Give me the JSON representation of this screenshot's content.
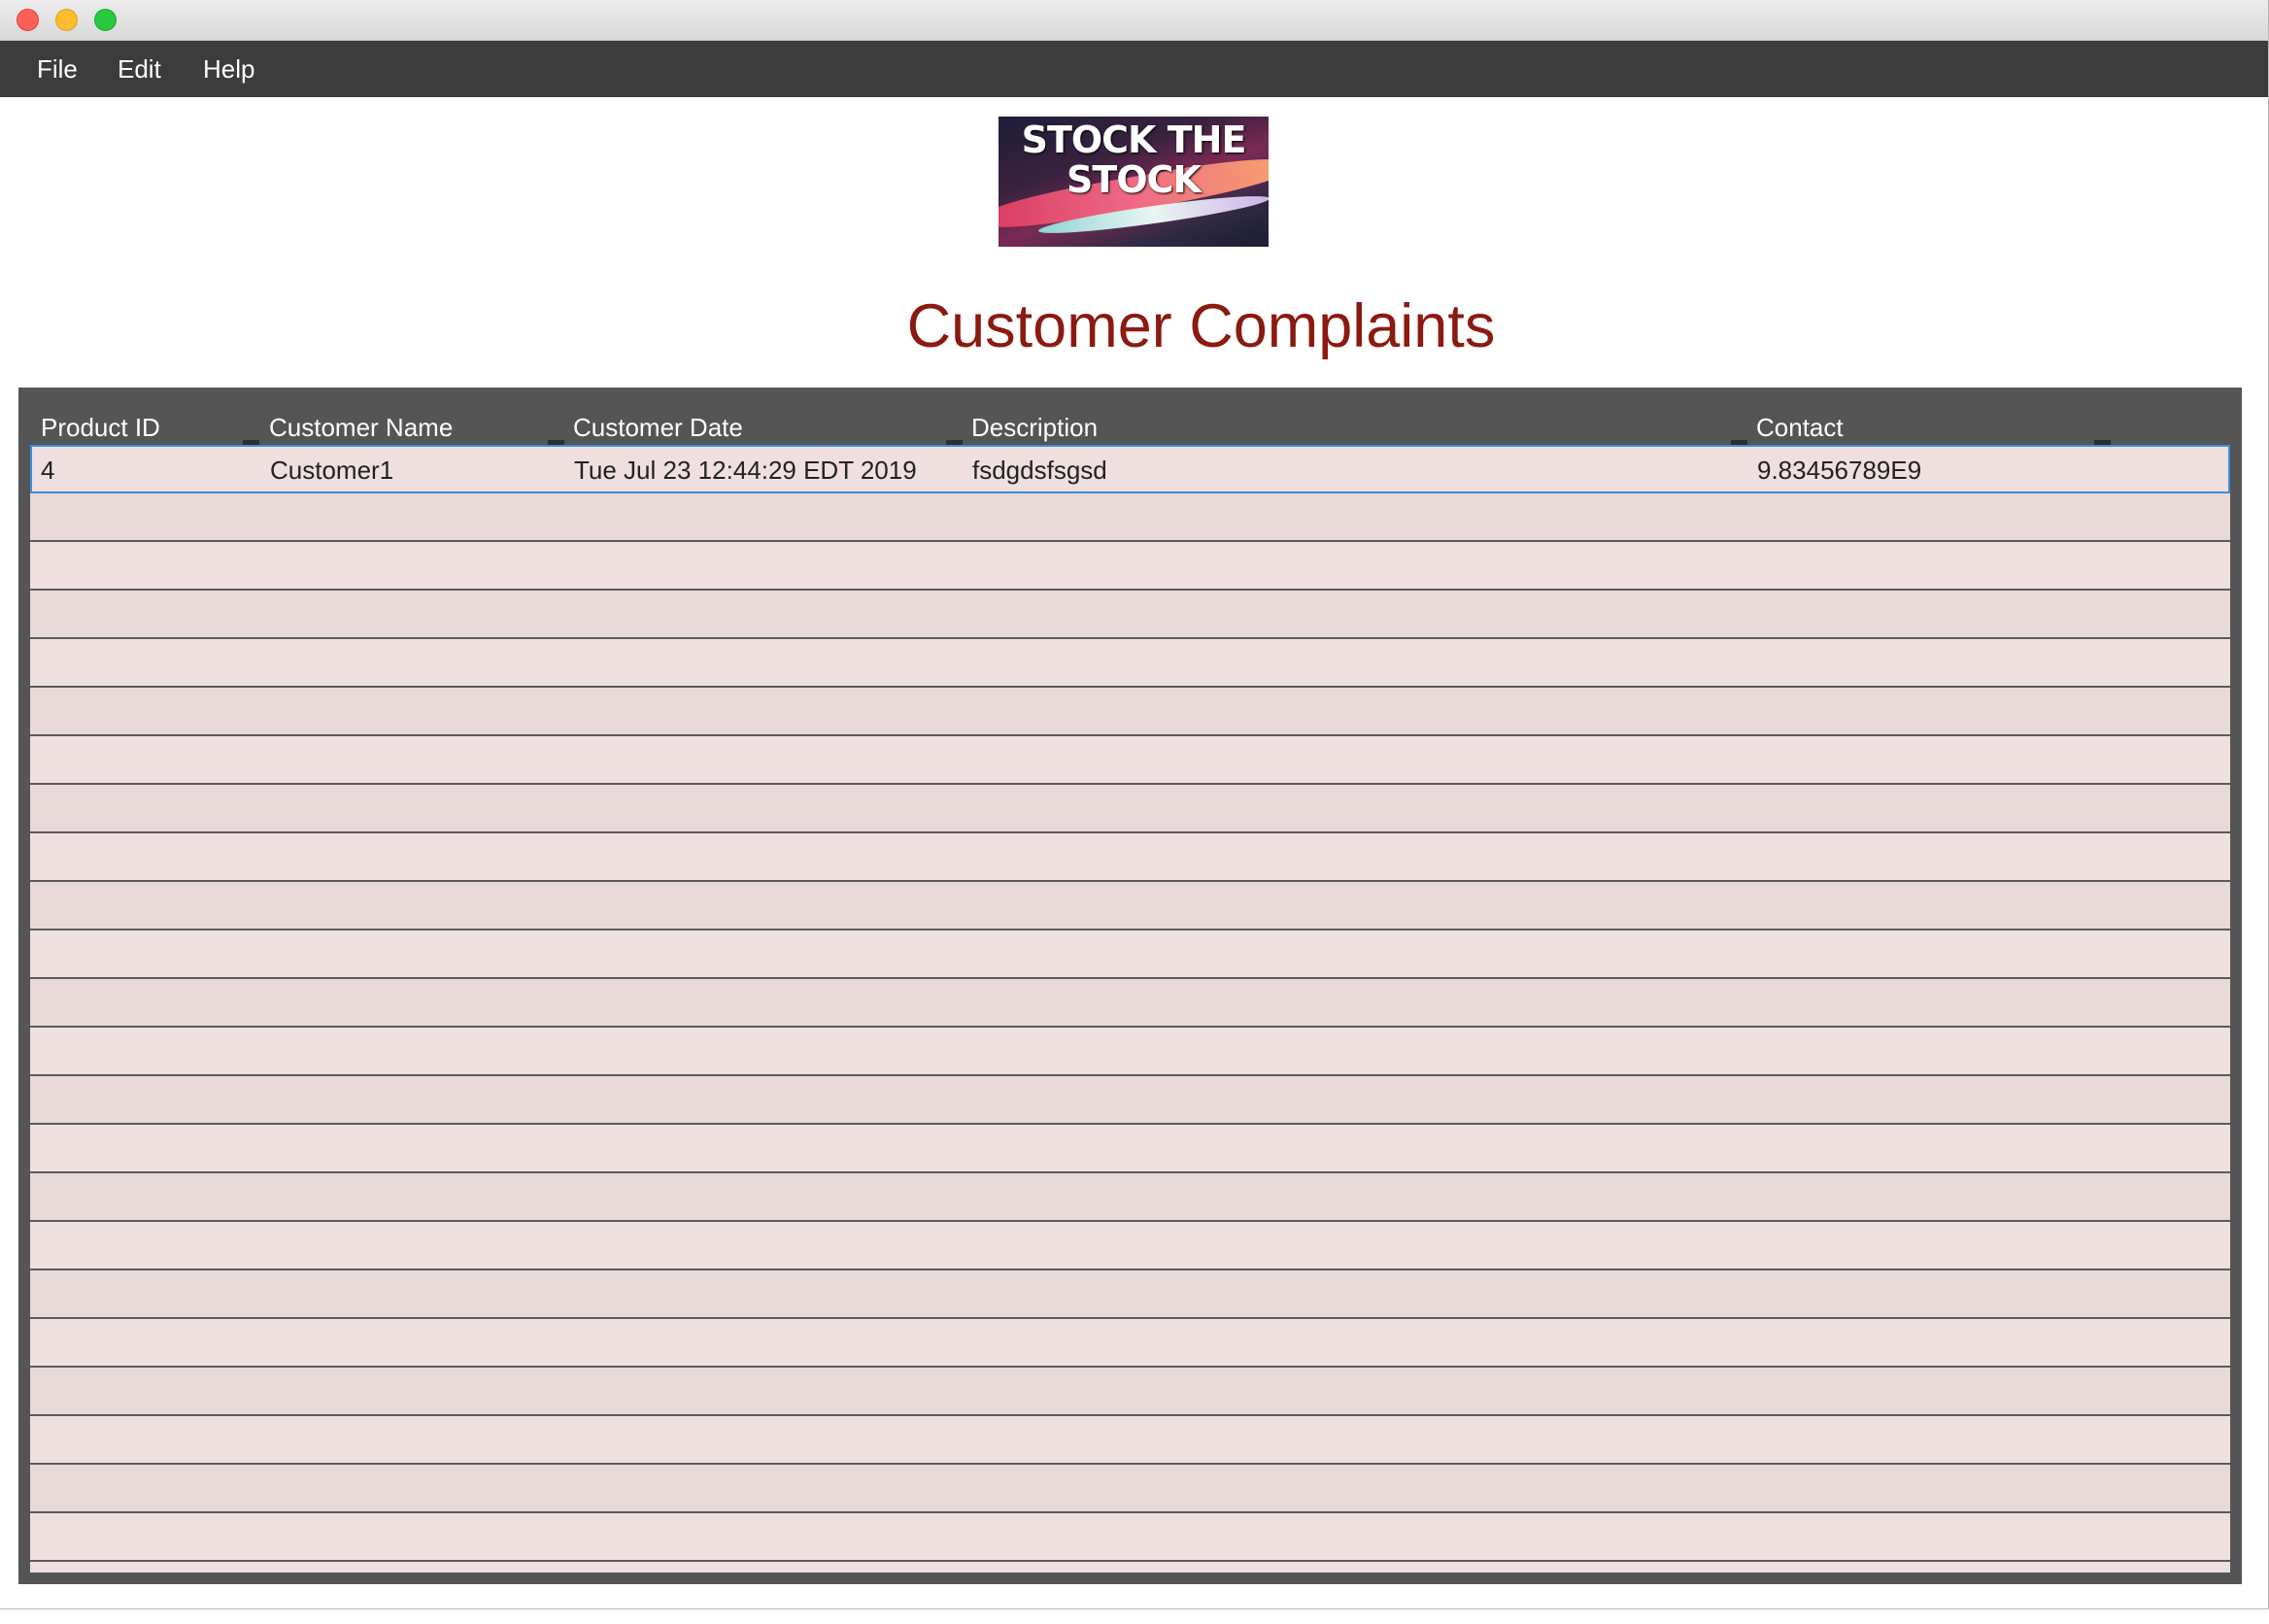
{
  "window": {
    "traffic_lights": [
      "close",
      "minimize",
      "maximize"
    ]
  },
  "menu": {
    "items": [
      "File",
      "Edit",
      "Help"
    ]
  },
  "logo": {
    "line1": "STOCK THE",
    "line2": "STOCK"
  },
  "page": {
    "title": "Customer Complaints"
  },
  "table": {
    "columns": [
      "Product ID",
      "Customer Name",
      "Customer Date",
      "Description",
      "Contact"
    ],
    "rows": [
      {
        "product_id": "4",
        "customer_name": "Customer1",
        "customer_date": "Tue Jul 23 12:44:29 EDT 2019",
        "description": "fsdgdsfsgsd",
        "contact": "9.83456789E9"
      }
    ],
    "selected_row": 0
  },
  "colors": {
    "title": "#8b1a10",
    "header_bg": "#555555",
    "row_bg": "#efdfdf",
    "menubar_bg": "#3c3c3c"
  }
}
